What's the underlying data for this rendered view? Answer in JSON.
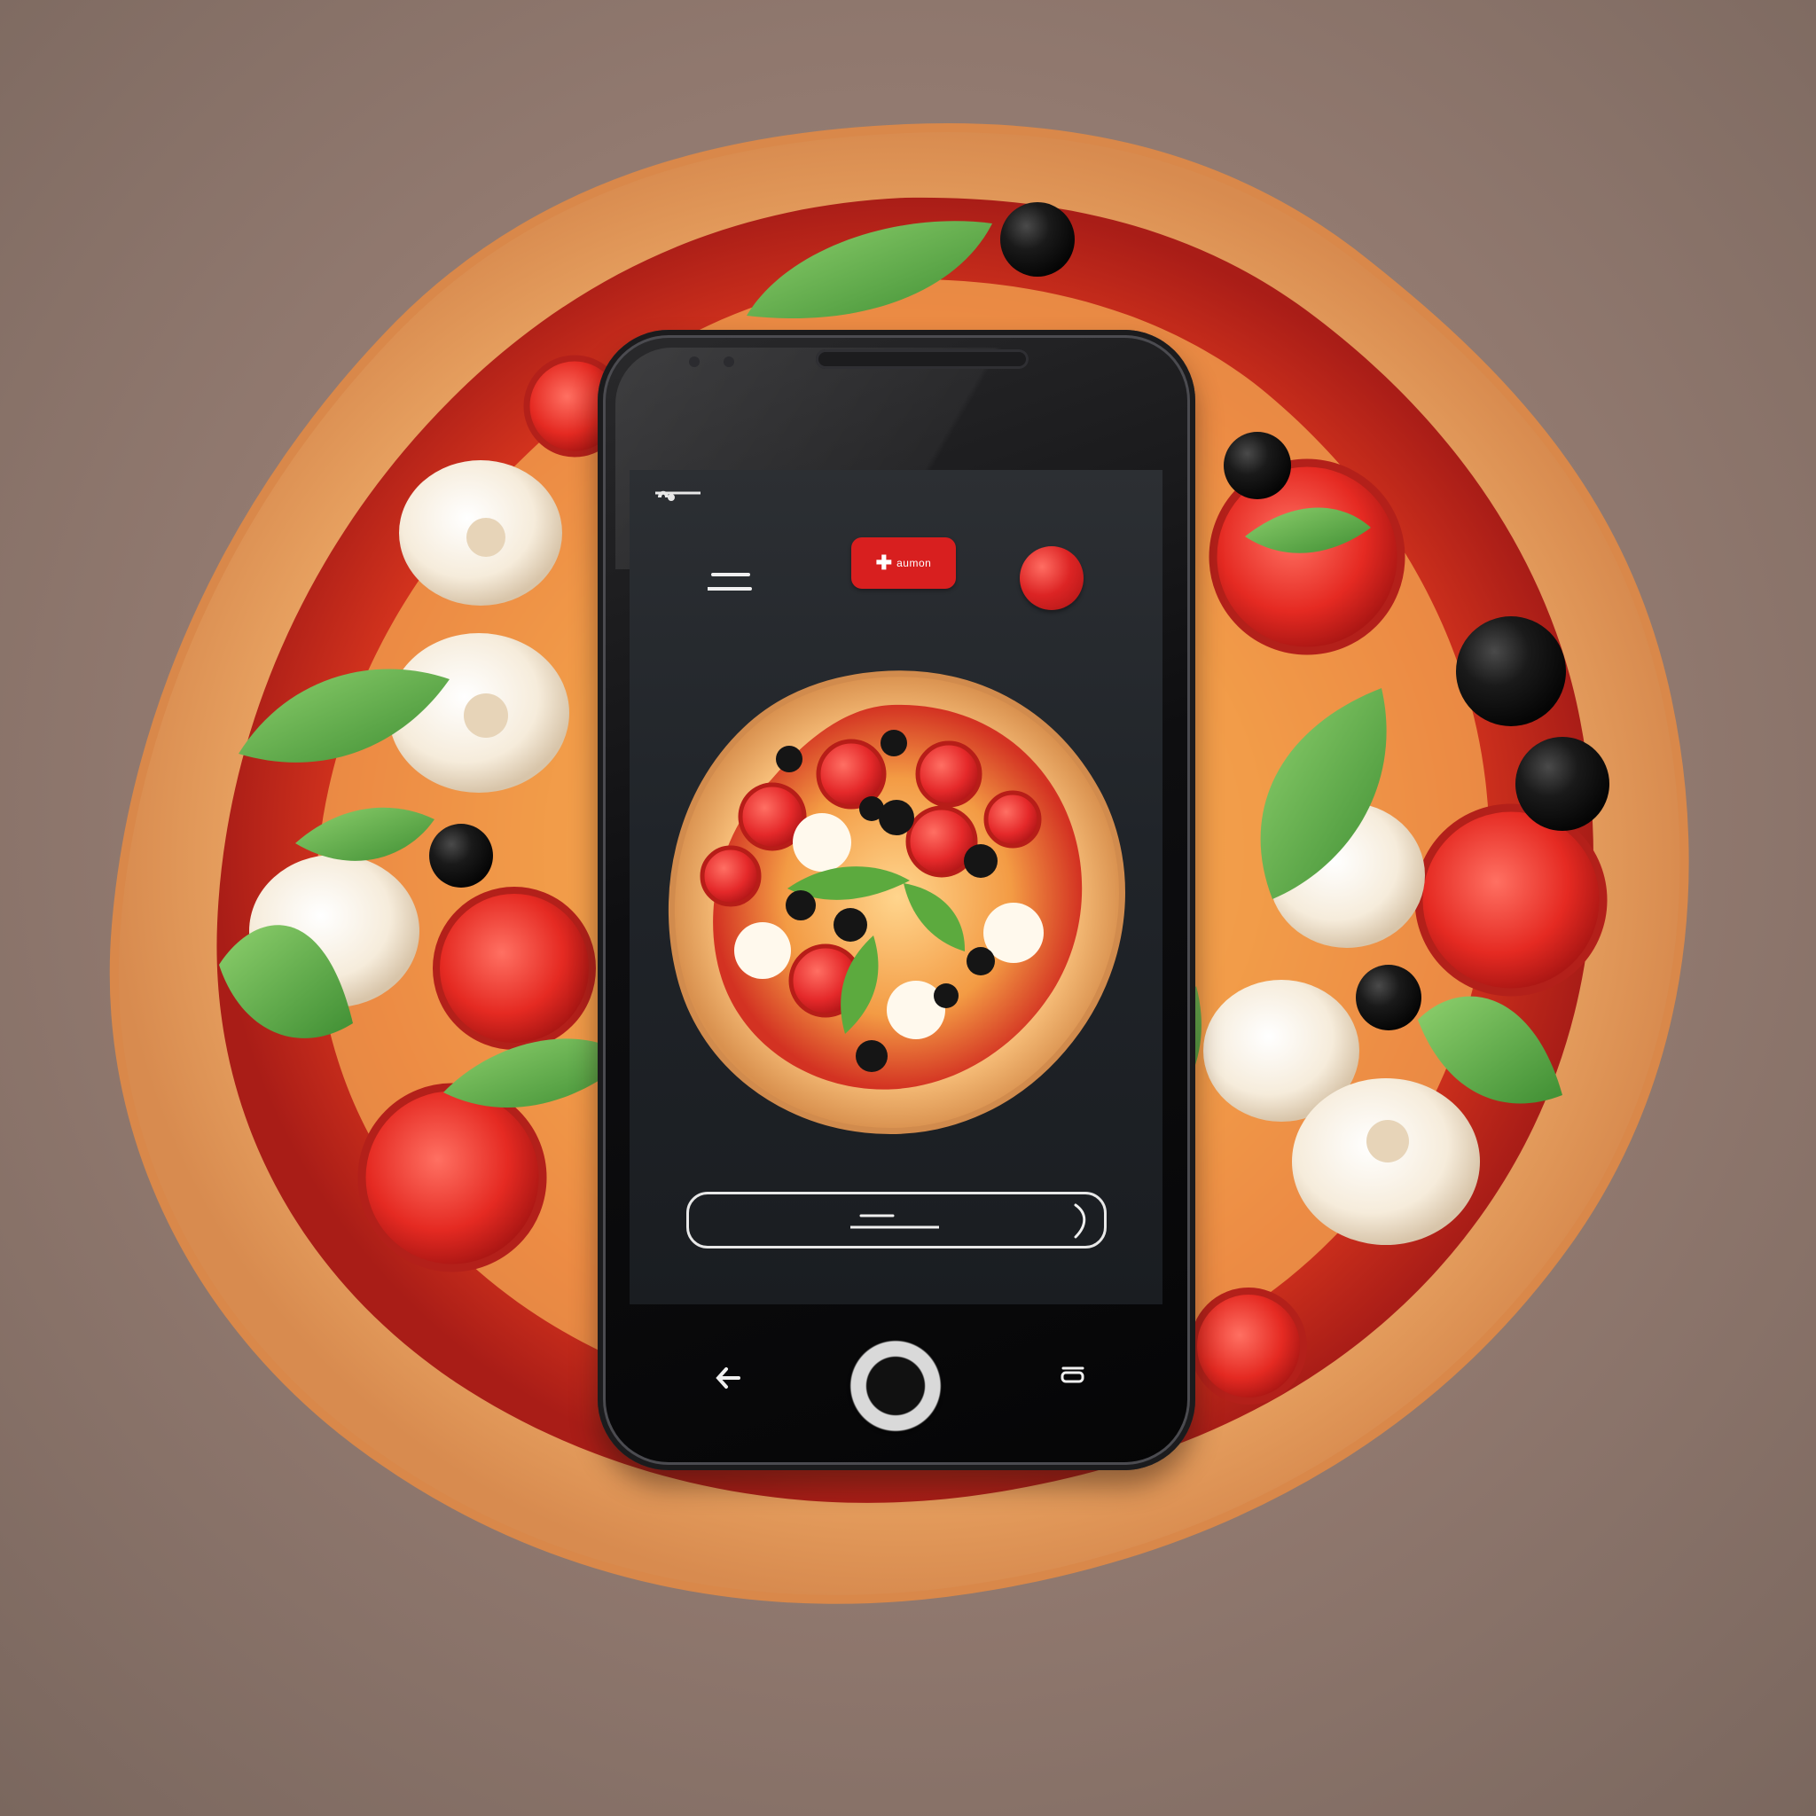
{
  "app": {
    "brand_label": "aumon",
    "brand_mark": "✚"
  },
  "icons": {
    "status": "status-icon",
    "menu": "menu-icon",
    "cart": "cart-dot-icon",
    "order_bar_lines": "lines-icon",
    "order_bar_caret": "caret-icon",
    "nav_left": "back-icon",
    "home": "home-button-icon",
    "nav_right": "recent-apps-icon"
  },
  "colors": {
    "background": "#8f7d72",
    "phone_body": "#0e0e10",
    "screen": "#202429",
    "brand_red": "#d81f1f",
    "cart_red": "#dc2424",
    "pizza_sauce": "#d9341f",
    "basil": "#58a644",
    "mozzarella": "#f5ecdc",
    "olive": "#141414",
    "crust": "#f0b66f"
  }
}
